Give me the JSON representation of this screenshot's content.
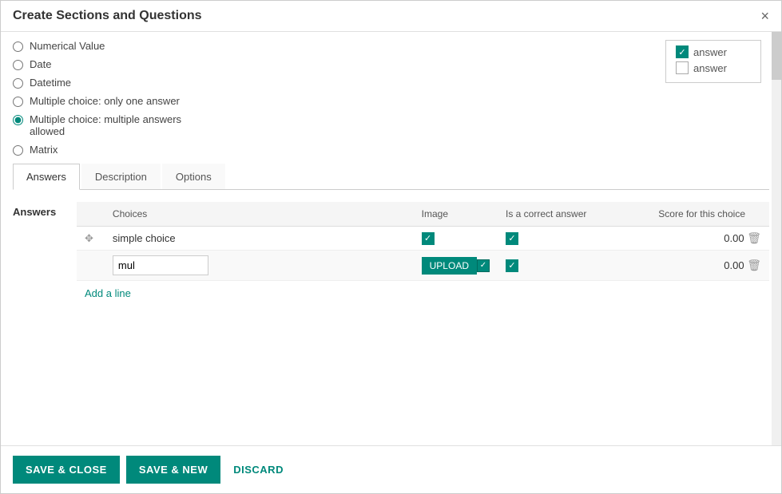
{
  "modal": {
    "title": "Create Sections and Questions",
    "close_label": "×"
  },
  "radio_options": [
    {
      "id": "numerical",
      "label": "Numerical Value",
      "checked": false
    },
    {
      "id": "date",
      "label": "Date",
      "checked": false
    },
    {
      "id": "datetime",
      "label": "Datetime",
      "checked": false
    },
    {
      "id": "single_choice",
      "label": "Multiple choice: only one answer",
      "checked": false
    },
    {
      "id": "multiple_choice",
      "label": "Multiple choice: multiple answers allowed",
      "checked": true
    },
    {
      "id": "matrix",
      "label": "Matrix",
      "checked": false
    }
  ],
  "preview": {
    "items": [
      {
        "label": "answer",
        "checked": true
      },
      {
        "label": "answer",
        "checked": false
      }
    ]
  },
  "tabs": [
    {
      "id": "answers",
      "label": "Answers",
      "active": true
    },
    {
      "id": "description",
      "label": "Description",
      "active": false
    },
    {
      "id": "options",
      "label": "Options",
      "active": false
    }
  ],
  "answers_section": {
    "label": "Answers",
    "columns": {
      "choices": "Choices",
      "image": "Image",
      "is_correct": "Is a correct answer",
      "score": "Score for this choice"
    },
    "rows": [
      {
        "id": 1,
        "choice": "simple choice",
        "has_image": true,
        "is_correct": true,
        "score": "0.00"
      },
      {
        "id": 2,
        "choice": "mul",
        "has_image": false,
        "uploading": true,
        "is_correct": true,
        "score": "0.00"
      }
    ],
    "add_line_label": "Add a line"
  },
  "footer": {
    "save_close": "SAVE & CLOSE",
    "save_new": "SAVE & NEW",
    "discard": "DISCARD"
  }
}
